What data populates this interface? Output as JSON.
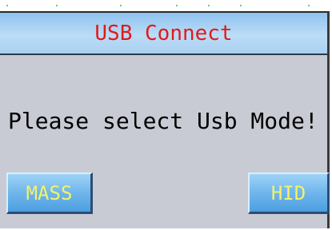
{
  "dialog": {
    "title": "USB Connect",
    "message": "Please select Usb Mode!",
    "buttons": {
      "mass_label": "MASS",
      "hid_label": "HID"
    }
  },
  "colors": {
    "title_text": "#e11a1a",
    "button_text": "#f2f26a",
    "dialog_bg": "#c8cbd3",
    "button_bg": "#6fb6ec"
  }
}
